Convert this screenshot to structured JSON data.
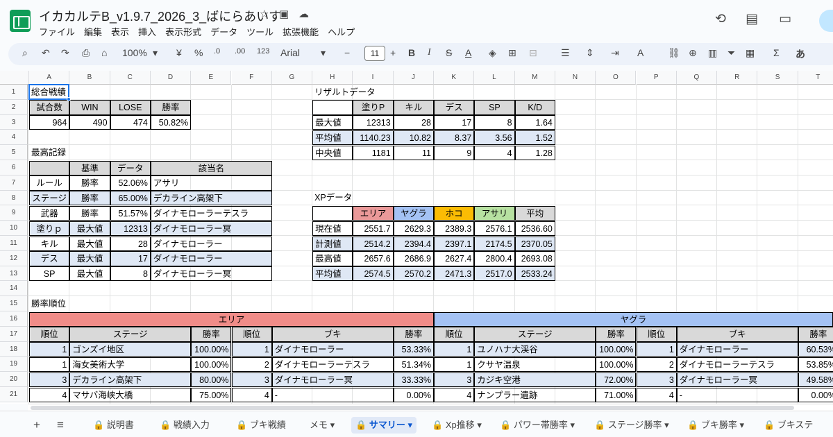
{
  "app": {
    "doc_title": "イカカルテB_v1.9.7_2026_3_ばにらあいす",
    "menu": [
      "ファイル",
      "編集",
      "表示",
      "挿入",
      "表示形式",
      "データ",
      "ツール",
      "拡張機能",
      "ヘルプ"
    ]
  },
  "toolbar": {
    "zoom": "100%",
    "currency": "¥",
    "percent": "%",
    "dec_minus": ".0",
    "dec_plus": ".00",
    "number_format": "123",
    "font": "Arial",
    "font_size": "11",
    "bold": "B",
    "italic": "I",
    "strike": "S",
    "text_color": "A",
    "font_color_icon": "A",
    "sum": "Σ",
    "input_tool": "あ"
  },
  "columns": [
    "A",
    "B",
    "C",
    "D",
    "E",
    "F",
    "G",
    "H",
    "I",
    "J",
    "K",
    "L",
    "M",
    "N",
    "O",
    "P",
    "Q",
    "R",
    "S",
    "T"
  ],
  "rows": [
    "1",
    "2",
    "3",
    "4",
    "5",
    "6",
    "7",
    "8",
    "9",
    "10",
    "11",
    "12",
    "13",
    "14",
    "15",
    "16",
    "17",
    "18",
    "19",
    "20",
    "21"
  ],
  "overall": {
    "title": "総合戦績",
    "headers": [
      "試合数",
      "WIN",
      "LOSE",
      "勝率"
    ],
    "values": [
      "964",
      "490",
      "474",
      "50.82%"
    ]
  },
  "best": {
    "title": "最高記録",
    "headers": [
      "",
      "基準",
      "データ",
      "該当名"
    ],
    "rows": [
      [
        "ルール",
        "勝率",
        "52.06%",
        "アサリ"
      ],
      [
        "ステージ",
        "勝率",
        "65.00%",
        "デカライン高架下"
      ],
      [
        "武器",
        "勝率",
        "51.57%",
        "ダイナモローラーテスラ"
      ],
      [
        "塗りｐ",
        "最大値",
        "12313",
        "ダイナモローラー冥"
      ],
      [
        "キル",
        "最大値",
        "28",
        "ダイナモローラー"
      ],
      [
        "デス",
        "最大値",
        "17",
        "ダイナモローラー"
      ],
      [
        "SP",
        "最大値",
        "8",
        "ダイナモローラー冥"
      ]
    ]
  },
  "result": {
    "title": "リザルトデータ",
    "headers": [
      "",
      "塗りP",
      "キル",
      "デス",
      "SP",
      "K/D"
    ],
    "rows": [
      [
        "最大値",
        "12313",
        "28",
        "17",
        "8",
        "1.64"
      ],
      [
        "平均値",
        "1140.23",
        "10.82",
        "8.37",
        "3.56",
        "1.52"
      ],
      [
        "中央値",
        "1181",
        "11",
        "9",
        "4",
        "1.28"
      ]
    ]
  },
  "xp": {
    "title": "XPデータ",
    "headers": [
      "",
      "エリア",
      "ヤグラ",
      "ホコ",
      "アサリ",
      "平均"
    ],
    "rows": [
      [
        "現在値",
        "2551.7",
        "2629.3",
        "2389.3",
        "2576.1",
        "2536.60"
      ],
      [
        "計測値",
        "2514.2",
        "2394.4",
        "2397.1",
        "2174.5",
        "2370.05"
      ],
      [
        "最高値",
        "2657.6",
        "2686.9",
        "2627.4",
        "2800.4",
        "2693.08"
      ],
      [
        "平均値",
        "2574.5",
        "2570.2",
        "2471.3",
        "2517.0",
        "2533.24"
      ]
    ]
  },
  "ranking": {
    "title": "勝率順位",
    "area_label": "エリア",
    "yagura_label": "ヤグラ",
    "headers": [
      "順位",
      "ステージ",
      "勝率",
      "順位",
      "ブキ",
      "勝率",
      "順位",
      "ステージ",
      "勝率",
      "順位",
      "ブキ",
      "勝率"
    ],
    "rows": [
      [
        "1",
        "ゴンズイ地区",
        "100.00%",
        "1",
        "ダイナモローラー",
        "53.33%",
        "1",
        "ユノハナ大渓谷",
        "100.00%",
        "1",
        "ダイナモローラー",
        "60.53%"
      ],
      [
        "1",
        "海女美術大学",
        "100.00%",
        "2",
        "ダイナモローラーテスラ",
        "51.34%",
        "1",
        "クサヤ温泉",
        "100.00%",
        "2",
        "ダイナモローラーテスラ",
        "53.85%"
      ],
      [
        "3",
        "デカライン高架下",
        "80.00%",
        "3",
        "ダイナモローラー冥",
        "33.33%",
        "3",
        "カジキ空港",
        "72.00%",
        "3",
        "ダイナモローラー冥",
        "49.58%"
      ],
      [
        "4",
        "マサバ海峡大橋",
        "75.00%",
        "4",
        "-",
        "0.00%",
        "4",
        "ナンプラー遺跡",
        "71.00%",
        "4",
        "-",
        "0.00%"
      ]
    ]
  },
  "tabs": [
    "説明書",
    "戦績入力",
    "ブキ戦績",
    "メモ",
    "サマリー",
    "Xp推移",
    "パワー帯勝率",
    "ステージ勝率",
    "ブキ勝率",
    "ブキステ"
  ],
  "active_tab": "サマリー"
}
